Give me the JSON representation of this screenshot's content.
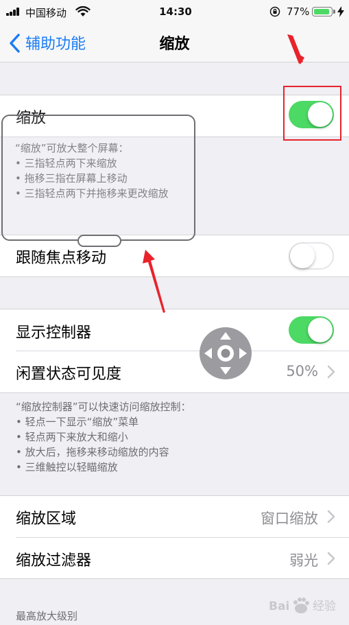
{
  "status_bar": {
    "carrier": "中国移动",
    "time": "14:30",
    "battery_percent": "77%",
    "battery_level": 0.77
  },
  "nav": {
    "back_label": "辅助功能",
    "title": "缩放"
  },
  "zoom": {
    "label": "缩放",
    "enabled": true,
    "description_title": "“缩放”可放大整个屏幕：",
    "description_items": [
      "• 三指轻点两下来缩放",
      "• 拖移三指在屏幕上移动",
      "• 三指轻点两下并拖移来更改缩放"
    ]
  },
  "follow_focus": {
    "label": "跟随焦点移动",
    "enabled": false
  },
  "show_controller": {
    "label": "显示控制器",
    "enabled": true
  },
  "idle_visibility": {
    "label": "闲置状态可见度",
    "value": "50%"
  },
  "controller_footer": {
    "title": "“缩放控制器”可以快速访问缩放控制：",
    "items": [
      "• 轻点一下显示“缩放”菜单",
      "• 轻点两下来放大和缩小",
      "• 放大后，拖移来移动缩放的内容",
      "• 三维触控以轻瞄缩放"
    ]
  },
  "zoom_region": {
    "label": "缩放区域",
    "value": "窗口缩放"
  },
  "zoom_filter": {
    "label": "缩放过滤器",
    "value": "弱光"
  },
  "max_zoom_header": "最高放大级别",
  "watermark": {
    "brand": "Bai",
    "suffix": "经验"
  },
  "colors": {
    "accent": "#1a7cf5",
    "toggle_on": "#4cd964",
    "annotation_red": "#e8232b"
  }
}
